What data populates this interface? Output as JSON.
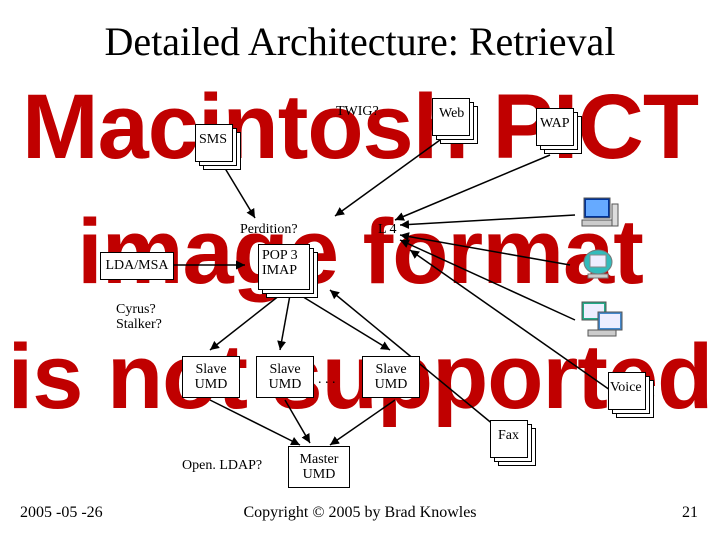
{
  "title": "Detailed Architecture: Retrieval",
  "background_lines": {
    "l1": "Macintosh PICT",
    "l2": "image format",
    "l3": "is not supported"
  },
  "labels": {
    "twig": "TWIG?",
    "web": "Web",
    "wap": "WAP",
    "sms": "SMS",
    "perdition": "Perdition?",
    "l4": "L 4",
    "lda_msa": "LDA/MSA",
    "pop3_imap": "POP 3\nIMAP",
    "cyrus_stalker": "Cyrus?\nStalker?",
    "slave_umd": "Slave\nUMD",
    "dots": ". . .",
    "fax": "Fax",
    "voice": "Voice",
    "open_ldap": "Open. LDAP?",
    "master_umd": "Master\nUMD"
  },
  "client_icons": {
    "desktop": "desktop-computer-icon",
    "imac": "imac-icon",
    "terminal": "terminal-server-icon"
  },
  "footer": {
    "date": "2005 -05 -26",
    "copyright": "Copyright © 2005 by Brad Knowles",
    "page": "21"
  }
}
